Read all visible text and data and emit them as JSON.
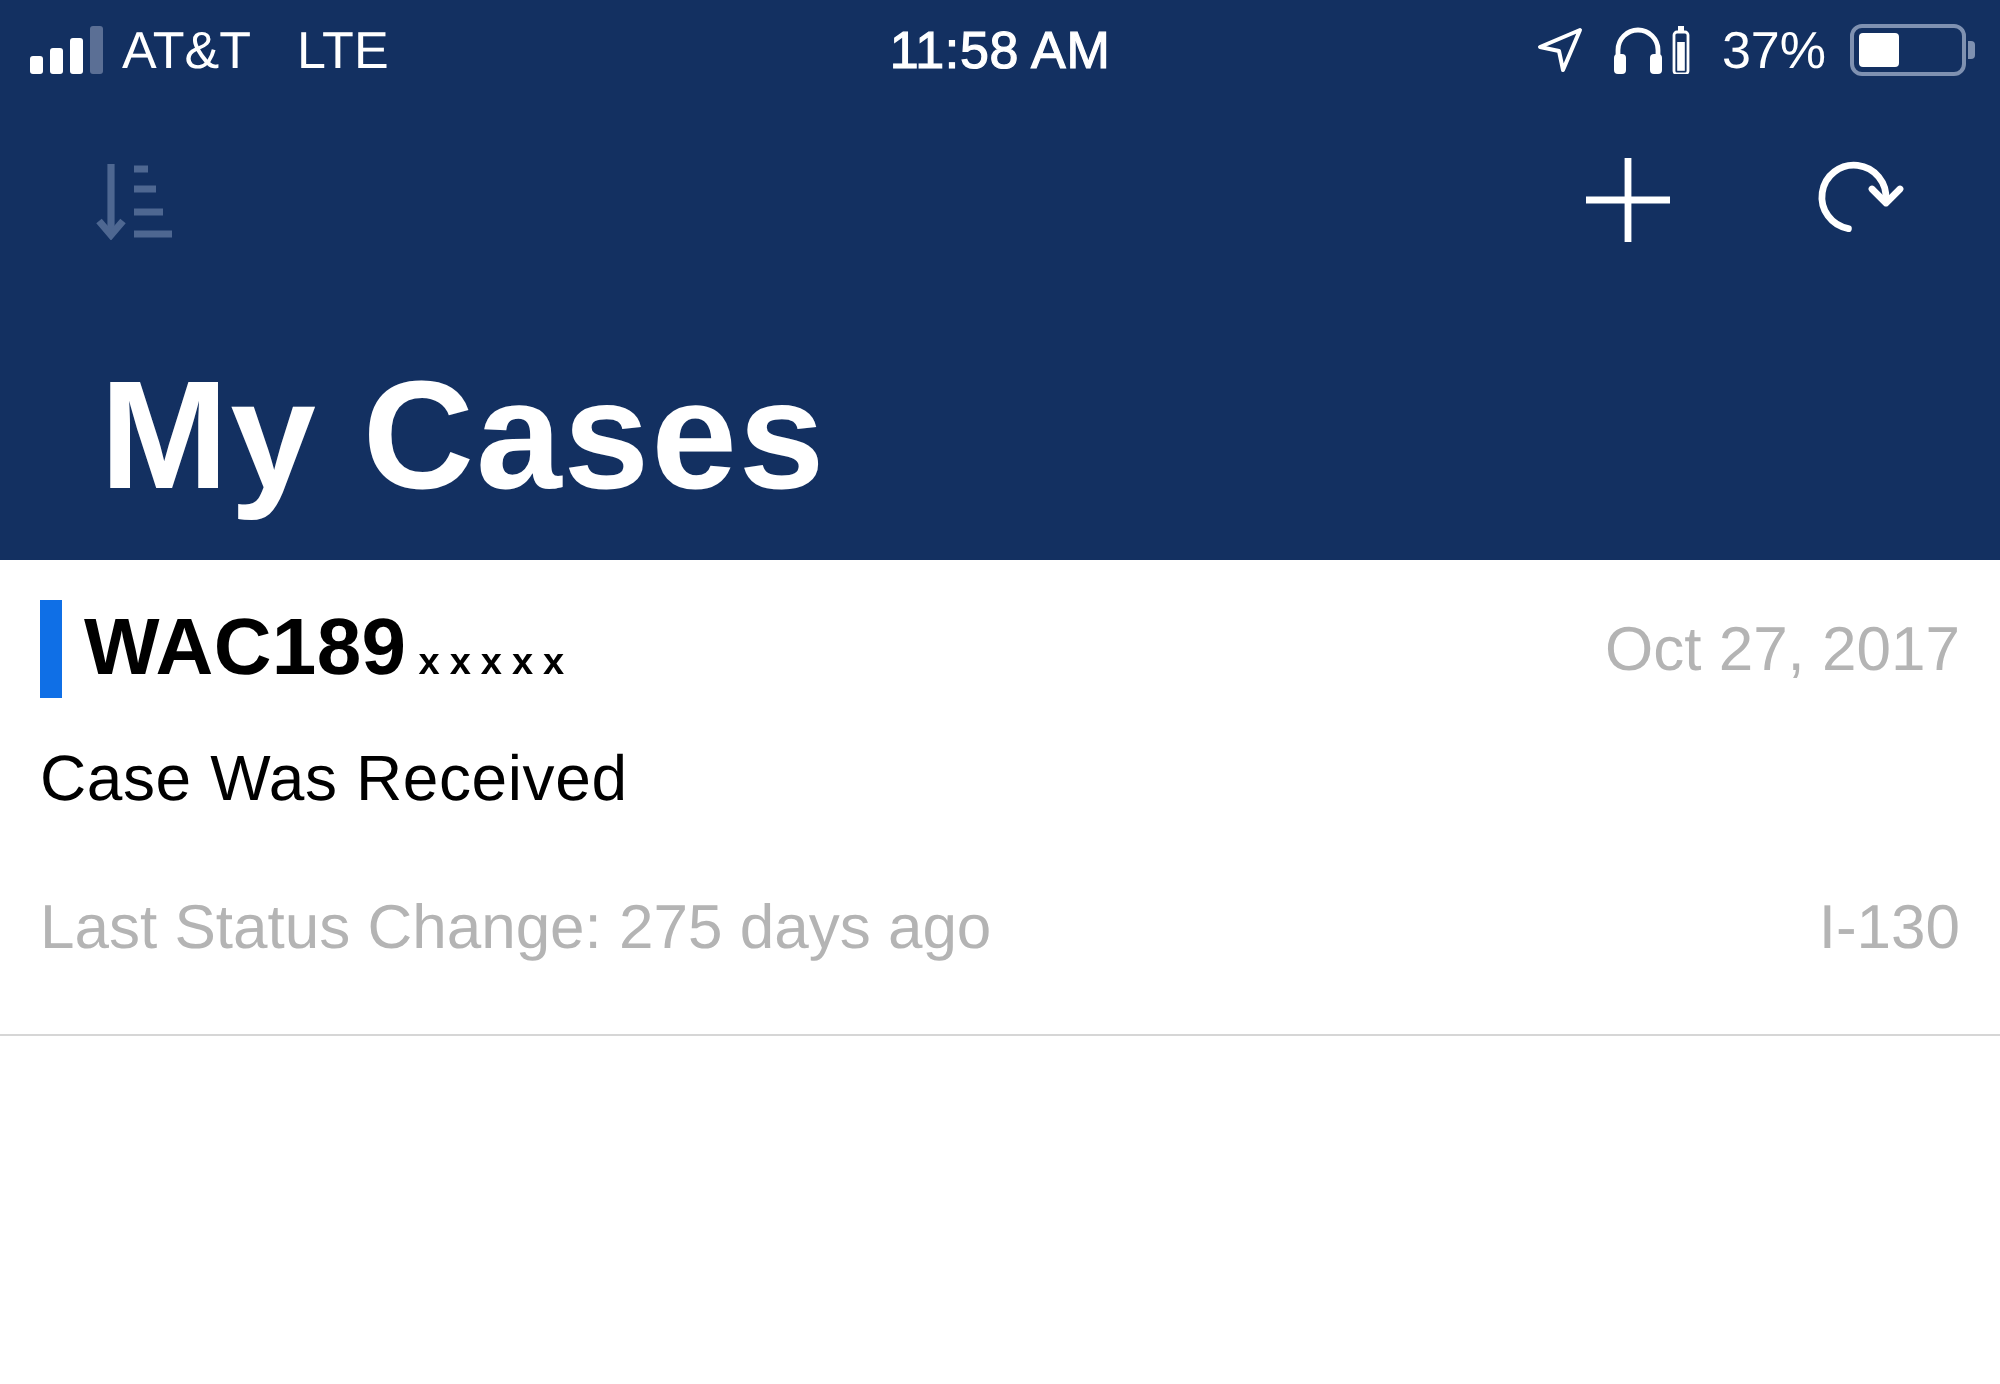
{
  "status_bar": {
    "carrier": "AT&T",
    "network": "LTE",
    "time": "11:58 AM",
    "battery_percent": "37%"
  },
  "toolbar": {
    "left": [
      {
        "kind": "sort",
        "disabled": true
      }
    ],
    "right": [
      {
        "kind": "add",
        "disabled": false
      },
      {
        "kind": "refresh",
        "disabled": false
      }
    ]
  },
  "title": "My Cases",
  "cases": [
    {
      "color": "#0f6fe6",
      "case_number": "WAC189",
      "redacted": "xxxxx",
      "date": "Oct 27, 2017",
      "status": "Case Was Received",
      "last_status_change": "Last Status Change: 275 days ago",
      "form": "I-130"
    }
  ]
}
